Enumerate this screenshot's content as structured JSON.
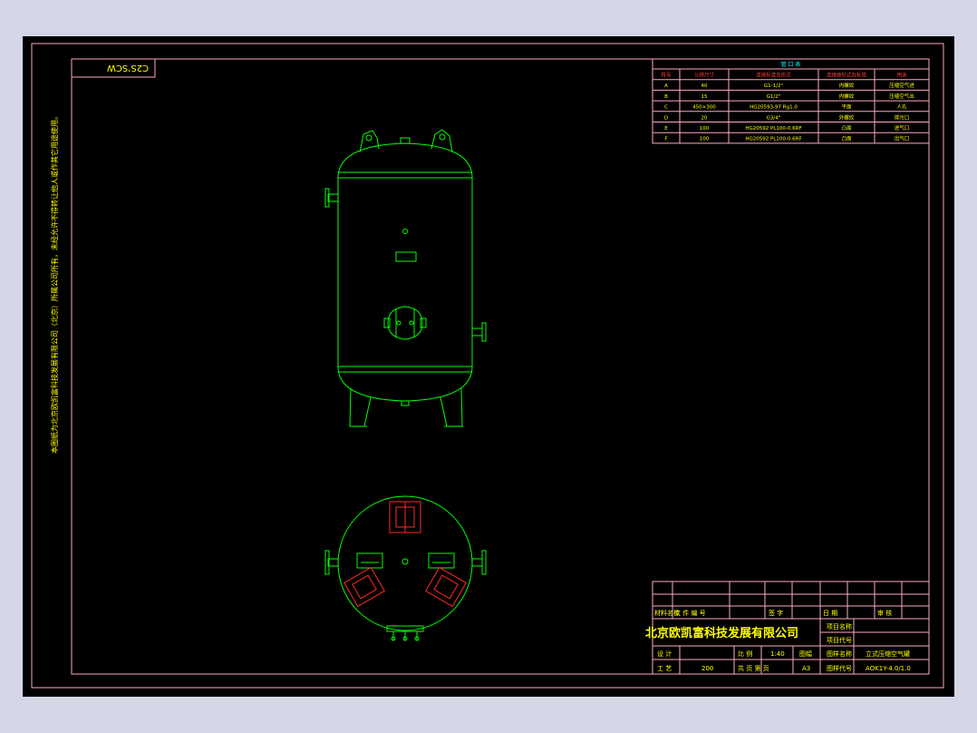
{
  "drawing": {
    "stamp": "C2S’SCW",
    "side_note": "本图纸为北京欧凯富科技发展有限公司（北京）所属公司所有，未经允许不得转让他人或作其它用途使用。"
  },
  "parts_table": {
    "title": "管 口 表",
    "headers": [
      "符号",
      "公称尺寸",
      "连接标准及形式",
      "连接面形式及标准",
      "用途"
    ],
    "rows": [
      [
        "A",
        "40",
        "G1-1/2\"",
        "内螺纹",
        "压缩空气进"
      ],
      [
        "B",
        "15",
        "G1/2\"",
        "内螺纹",
        "压缩空气出"
      ],
      [
        "C",
        "450×300",
        "HG20593-97 Rg1.0",
        "平面",
        "人孔"
      ],
      [
        "D",
        "20",
        "G3/4\"",
        "外螺纹",
        "排污口"
      ],
      [
        "E",
        "100",
        "HG20592 PL100-0.6RF",
        "凸面",
        "进气口"
      ],
      [
        "F",
        "100",
        "HG20592 PL100-0.6RF",
        "凸面",
        "出气口"
      ]
    ]
  },
  "title_block": {
    "company": "北京欧凯富科技发展有限公司",
    "row_labels": {
      "material": "材料名称",
      "tech": "文 件 编 号",
      "signature": "签 字",
      "date": "日 期",
      "approve": "审 核",
      "project_name": "项目名称",
      "project_no": "项目代号",
      "design": "设 计",
      "scale": "比 例",
      "scale_value": "1:40",
      "sheet": "图幅",
      "drawing_name": "图样名称",
      "drawing_name_value": "立式压缩空气罐",
      "check": "工 艺",
      "weight": "重量",
      "weight_value": "200",
      "sheet_of": "共 页 第 页",
      "format_value": "A3",
      "drawing_no": "图样代号",
      "drawing_no_value": "AOK1Y-4.0/1.0"
    }
  },
  "colors": {
    "frame": "#ffa8c0",
    "vessel": "#00ff00",
    "hidden": "#ff2a2a",
    "text": "#ffff00",
    "table_title": "#00ffff",
    "background": "#000000"
  }
}
